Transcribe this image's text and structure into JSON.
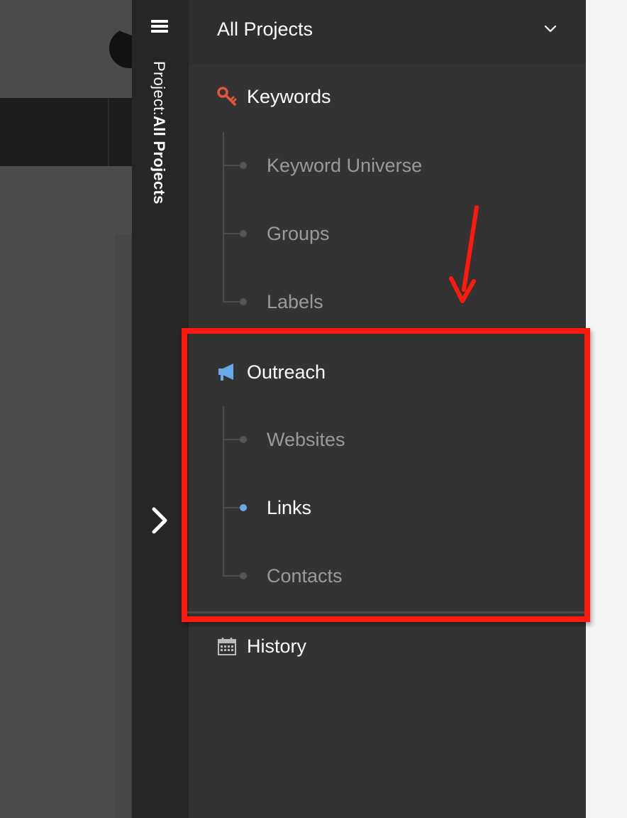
{
  "rail": {
    "project_label": "Project:",
    "project_value": "All Projects"
  },
  "panel": {
    "title": "All Projects",
    "sections": [
      {
        "label": "Keywords",
        "icon": "key-icon",
        "icon_color": "#e8553e",
        "items": [
          {
            "label": "Keyword Universe",
            "active": false
          },
          {
            "label": "Groups",
            "active": false
          },
          {
            "label": "Labels",
            "active": false
          }
        ]
      },
      {
        "label": "Outreach",
        "icon": "megaphone-icon",
        "icon_color": "#6aa9e8",
        "items": [
          {
            "label": "Websites",
            "active": false
          },
          {
            "label": "Links",
            "active": true
          },
          {
            "label": "Contacts",
            "active": false
          }
        ]
      },
      {
        "label": "History",
        "icon": "calendar-icon",
        "icon_color": "#bbbbbb",
        "items": []
      }
    ]
  },
  "colors": {
    "panel_bg": "#333333",
    "rail_bg": "#262626",
    "active_dot": "#6aa9e8",
    "annotation_red": "#ff1a0d"
  }
}
